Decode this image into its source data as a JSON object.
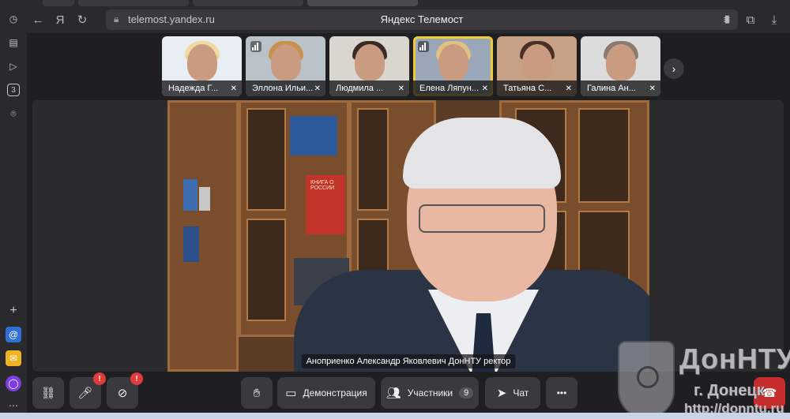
{
  "browser": {
    "url": "telemost.yandex.ru",
    "page_title": "Яндекс Телемост"
  },
  "sidebar": {
    "badge_number": "3"
  },
  "participants": [
    {
      "name": "Надежда Г...",
      "hair": "#f0d9a0",
      "bg": "#e8eef4",
      "active": false,
      "speaking": false
    },
    {
      "name": "Эллона Ильи...",
      "hair": "#c98f4c",
      "bg": "#b9c1c9",
      "active": false,
      "speaking": true
    },
    {
      "name": "Людмила ...",
      "hair": "#3a2a24",
      "bg": "#d9d6cf",
      "active": false,
      "speaking": false
    },
    {
      "name": "Елена Ляпун...",
      "hair": "#e2c083",
      "bg": "#9aa7b8",
      "active": true,
      "speaking": true
    },
    {
      "name": "Татьяна С...",
      "hair": "#4a2f24",
      "bg": "#c7a186",
      "active": false,
      "speaking": false
    },
    {
      "name": "Галина Ан...",
      "hair": "#8a7a70",
      "bg": "#dcdcdc",
      "active": false,
      "speaking": false
    }
  ],
  "main_video": {
    "caption": "Аноприенко Александр Яковлевич ДонНТУ ректор",
    "book_text": "КНИГА О РОССИИ"
  },
  "controls": {
    "demo_label": "Демонстрация",
    "participants_label": "Участники",
    "participants_count": "9",
    "chat_label": "Чат",
    "mic_alert": "!",
    "cam_alert": "!",
    "more_label": "•••"
  },
  "watermark": {
    "name": "ДонНТУ",
    "city": "г. Донецк",
    "site": "http://donntu.ru"
  },
  "colors": {
    "active_tile": "#f2cb3a",
    "hangup": "#c62d2d",
    "alert": "#e23b3b"
  }
}
